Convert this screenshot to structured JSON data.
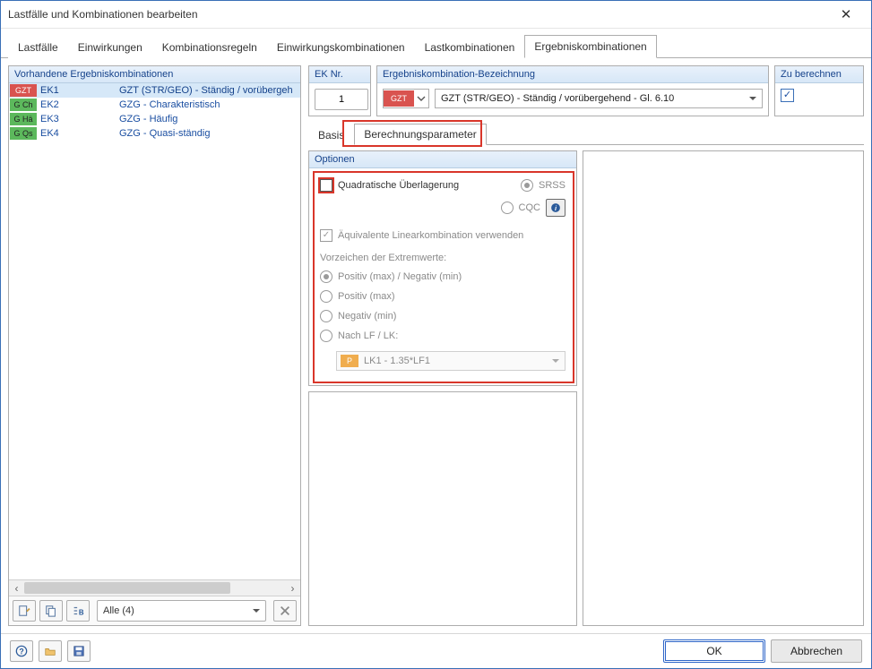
{
  "window": {
    "title": "Lastfälle und Kombinationen bearbeiten"
  },
  "tabs": {
    "items": [
      {
        "label": "Lastfälle"
      },
      {
        "label": "Einwirkungen"
      },
      {
        "label": "Kombinationsregeln"
      },
      {
        "label": "Einwirkungskombinationen"
      },
      {
        "label": "Lastkombinationen"
      },
      {
        "label": "Ergebniskombinationen"
      }
    ],
    "active_index": 5
  },
  "sidebar": {
    "header": "Vorhandene Ergebniskombinationen",
    "rows": [
      {
        "tag": "GZT",
        "tag_color": "red",
        "ek": "EK1",
        "desc": "GZT (STR/GEO) - Ständig / vorübergeh",
        "selected": true
      },
      {
        "tag": "G Ch",
        "tag_color": "green",
        "ek": "EK2",
        "desc": "GZG - Charakteristisch",
        "selected": false
      },
      {
        "tag": "G Hä",
        "tag_color": "green",
        "ek": "EK3",
        "desc": "GZG - Häufig",
        "selected": false
      },
      {
        "tag": "G Qs",
        "tag_color": "green",
        "ek": "EK4",
        "desc": "GZG - Quasi-ständig",
        "selected": false
      }
    ],
    "filter": {
      "label": "Alle (4)"
    }
  },
  "top": {
    "eknr": {
      "label": "EK Nr.",
      "value": "1"
    },
    "rcname": {
      "label": "Ergebniskombination-Bezeichnung",
      "tag": "GZT",
      "name": "GZT (STR/GEO) - Ständig / vorübergehend - Gl. 6.10"
    },
    "calc": {
      "label": "Zu berechnen",
      "checked": true
    }
  },
  "subtabs": {
    "items": [
      {
        "label": "Basis"
      },
      {
        "label": "Berechnungsparameter"
      }
    ],
    "active_index": 1
  },
  "options": {
    "header": "Optionen",
    "quadratic_label": "Quadratische Überlagerung",
    "srss_label": "SRSS",
    "cqc_label": "CQC",
    "equiv_label": "Äquivalente Linearkombination verwenden",
    "sign_header": "Vorzeichen der Extremwerte:",
    "signs": [
      {
        "label": "Positiv (max) / Negativ (min)",
        "selected": true
      },
      {
        "label": "Positiv (max)",
        "selected": false
      },
      {
        "label": "Negativ (min)",
        "selected": false
      },
      {
        "label": "Nach LF / LK:",
        "selected": false
      }
    ],
    "lk": {
      "tag": "P",
      "label": "LK1 - 1.35*LF1"
    }
  },
  "footer": {
    "ok": "OK",
    "cancel": "Abbrechen"
  },
  "icons": {
    "new": "new-icon",
    "copy": "copy-icon",
    "renumber": "renumber-icon",
    "delete": "delete-icon",
    "help": "help-icon",
    "open": "open-icon",
    "save": "save-icon",
    "info": "info-icon"
  }
}
